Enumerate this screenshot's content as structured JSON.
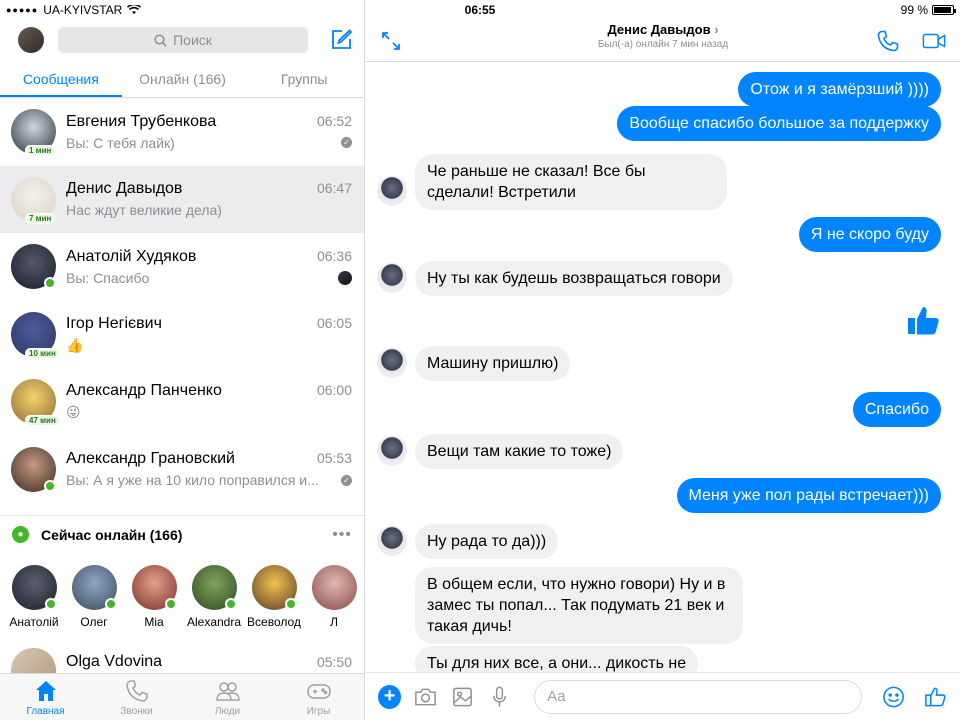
{
  "status_bar": {
    "carrier": "UA-KYIVSTAR",
    "time": "06:55",
    "battery": "99 %"
  },
  "sidebar": {
    "search_placeholder": "Поиск",
    "tabs": [
      {
        "label": "Сообщения",
        "active": true
      },
      {
        "label": "Онлайн (166)",
        "active": false
      },
      {
        "label": "Группы",
        "active": false
      }
    ],
    "conversations": [
      {
        "name": "Евгения Трубенкова",
        "time": "06:52",
        "preview": "Вы: С тебя лайк)",
        "badge": "1 мин",
        "colors": [
          "#cfd8dc",
          "#263238"
        ]
      },
      {
        "name": "Денис Давыдов",
        "time": "06:47",
        "preview": "Нас ждут великие дела)",
        "badge": "7 мин",
        "colors": [
          "#f3f1ec",
          "#d8d2c4"
        ]
      },
      {
        "name": "Анатолій Худяков",
        "time": "06:36",
        "preview": "Вы: Спасибо",
        "badge": "",
        "colors": [
          "#54586a",
          "#1a1c26"
        ]
      },
      {
        "name": "Ігор Негієвич",
        "time": "06:05",
        "preview": "👍",
        "badge": "10 мин",
        "colors": [
          "#4d5c9a",
          "#2b3566"
        ]
      },
      {
        "name": "Александр Панченко",
        "time": "06:00",
        "preview": "😜",
        "badge": "47 мин",
        "colors": [
          "#f6d36b",
          "#8a6a3a"
        ]
      },
      {
        "name": "Александр Грановский",
        "time": "05:53",
        "preview": "Вы: А я уже на 10 кило поправился и...",
        "badge": "",
        "colors": [
          "#c49a82",
          "#3c2a22"
        ]
      }
    ],
    "online": {
      "title": "Сейчас онлайн (166)",
      "people": [
        {
          "name": "Анатолій",
          "colors": [
            "#5a5f70",
            "#1d1f2a"
          ]
        },
        {
          "name": "Олег",
          "colors": [
            "#8fa7c0",
            "#3a4a5e"
          ]
        },
        {
          "name": "Mia",
          "colors": [
            "#e2a28a",
            "#7a2e2a"
          ]
        },
        {
          "name": "Alexandra",
          "colors": [
            "#7fa35a",
            "#2e4a22"
          ]
        },
        {
          "name": "Всеволод",
          "colors": [
            "#f2c14e",
            "#5a3a2a"
          ]
        },
        {
          "name": "Л",
          "colors": [
            "#e0b8b0",
            "#8a4a4a"
          ]
        }
      ]
    },
    "last_conversation": {
      "name": "Olga Vdovina",
      "time": "05:50"
    },
    "bottom_tabs": [
      {
        "label": "Главная",
        "icon": "home-icon",
        "active": true
      },
      {
        "label": "Звонки",
        "icon": "phone-icon",
        "active": false
      },
      {
        "label": "Люди",
        "icon": "people-icon",
        "active": false
      },
      {
        "label": "Игры",
        "icon": "gamepad-icon",
        "active": false
      }
    ]
  },
  "chat": {
    "contact_name": "Денис Давыдов",
    "contact_status": "Был(-а) онлайн 7 мин назад",
    "messages": [
      {
        "dir": "out",
        "text": "Отож и я замёрзший ))))"
      },
      {
        "dir": "out",
        "text": "Вообще спасибо большое за поддержку"
      },
      {
        "dir": "in",
        "text": "Че раньше не сказал! Все бы сделали! Встретили"
      },
      {
        "dir": "out",
        "text": "Я не скоро буду"
      },
      {
        "dir": "in",
        "text": "Ну ты как будешь возвращаться говори"
      },
      {
        "dir": "out",
        "text": "👍",
        "kind": "like"
      },
      {
        "dir": "in",
        "text": "Машину пришлю)"
      },
      {
        "dir": "out",
        "text": "Спасибо"
      },
      {
        "dir": "in",
        "text": "Вещи там какие то тоже)"
      },
      {
        "dir": "out",
        "text": "Меня уже пол рады встречает)))"
      },
      {
        "dir": "in",
        "text": "Ну рада то да)))"
      },
      {
        "dir": "in",
        "text": "В общем если, что нужно говори) Ну и в замес ты попал... Так подумать 21 век и такая дичь!"
      },
      {
        "dir": "in",
        "text": "Ты для них все, а они... дикость не"
      }
    ],
    "composer_placeholder": "Aa",
    "accent": "#0084ff"
  }
}
